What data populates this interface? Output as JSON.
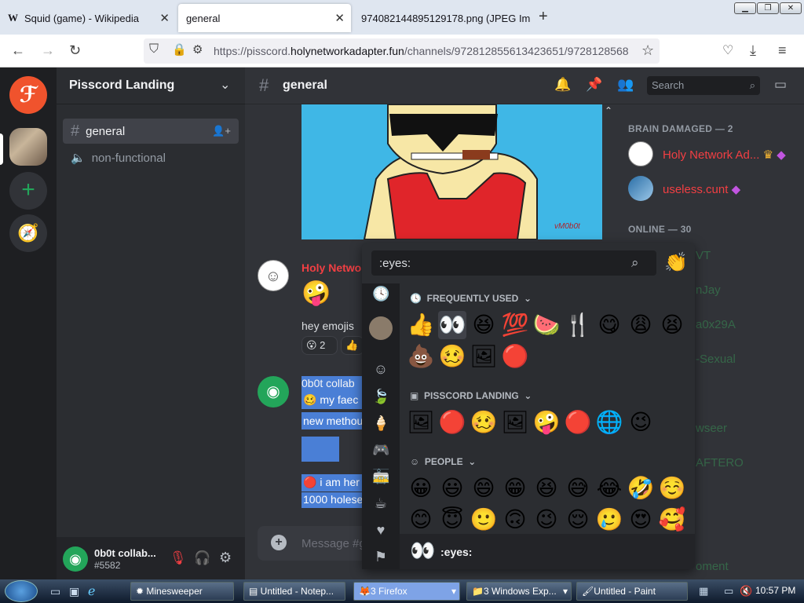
{
  "browser": {
    "tabs": [
      {
        "icon": "W",
        "label": "Squid (game) - Wikipedia"
      },
      {
        "label": "general"
      },
      {
        "label": "974082144895129178.png (JPEG Ima"
      }
    ],
    "url_prefix": "https://pisscord.",
    "url_host": "holynetworkadapter.fun",
    "url_path": "/channels/972812855613423651/9728128568"
  },
  "server": {
    "name": "Pisscord Landing"
  },
  "channels": [
    {
      "label": "general",
      "type": "text"
    },
    {
      "label": "non-functional",
      "type": "voice"
    }
  ],
  "header": {
    "channel": "general",
    "search_placeholder": "Search"
  },
  "image_watermark": "vM0b0t",
  "messages": [
    {
      "author": "Holy Netwo",
      "text": "hey emojis",
      "reaction": "2"
    },
    {
      "author": "0b0t collab",
      "lines": [
        "my faec",
        "new methou",
        "i am her",
        "1000 holese"
      ]
    }
  ],
  "composer": {
    "placeholder": "Message #g"
  },
  "members": {
    "group1": "BRAIN DAMAGED — 2",
    "group1_members": [
      "Holy Network Ad...",
      "useless.cunt"
    ],
    "group2": "ONLINE — 30",
    "faded": [
      "VT",
      "nJay",
      "a0x29A",
      "-Sexual",
      "wseer",
      "AFTERO",
      "oment"
    ]
  },
  "picker": {
    "search_value": ":eyes:",
    "sections": [
      "FREQUENTLY USED",
      "PISSCORD LANDING",
      "PEOPLE"
    ],
    "frequent": [
      "👍",
      "👀",
      "😆",
      "💯",
      "🍉",
      "🍴",
      "😋",
      "😩",
      "😫",
      "💩",
      "🥴",
      "🖼",
      "🔴"
    ],
    "server": [
      "🖼",
      "🔴",
      "🥴",
      "🖼",
      "🤪",
      "🔴",
      "🌐",
      "😉"
    ],
    "people": [
      "😀",
      "😃",
      "😄",
      "😁",
      "😆",
      "😅",
      "😂",
      "🤣",
      "☺️",
      "😊",
      "😇",
      "🙂",
      "🙃",
      "😉",
      "😌",
      "🥲",
      "😍",
      "🥰"
    ],
    "footer_emoji": "👀",
    "footer_label": ":eyes:"
  },
  "user": {
    "name": "0b0t collab...",
    "tag": "#5582"
  },
  "taskbar": {
    "items": [
      "Minesweeper",
      "Untitled - Notep...",
      "3  Firefox",
      "3 Windows Exp...",
      "Untitled - Paint"
    ],
    "clock": "10:57 PM"
  }
}
